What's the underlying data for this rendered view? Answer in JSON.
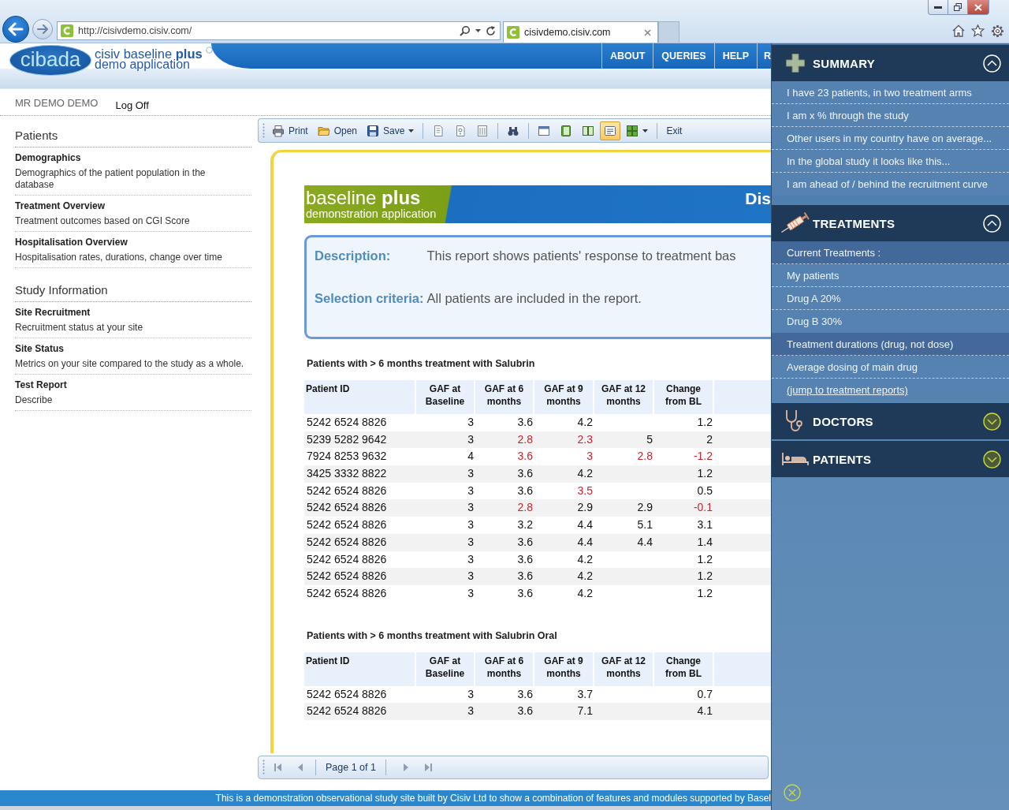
{
  "browser": {
    "address": "http://cisivdemo.cisiv.com/",
    "tabs": [
      {
        "label": "cisivdemo.cisiv.com",
        "selected": true
      }
    ]
  },
  "header": {
    "logo": "cibada",
    "brand": [
      "cisiv baseline **plus**",
      "demo application"
    ],
    "nav": [
      "ABOUT",
      "QUERIES",
      "HELP",
      "R"
    ]
  },
  "user_bar": {
    "user": "MR DEMO DEMO",
    "log_off": "Log Off"
  },
  "sidebar": {
    "sections": [
      {
        "title": "Patients",
        "items": [
          {
            "title": "Demographics",
            "description": "Demographics of the patient population in the database"
          },
          {
            "title": "Treatment Overview",
            "description": "Treatment outcomes based on CGI Score"
          },
          {
            "title": "Hospitalisation Overview",
            "description": "Hospitalisation rates, durations, change over time"
          }
        ]
      },
      {
        "title": "Study Information",
        "items": [
          {
            "title": "Site Recruitment",
            "description": "Recruitment status at your site"
          },
          {
            "title": "Site Status",
            "description": "Metrics on your site compared to the study as a whole."
          },
          {
            "title": "Test Report",
            "description": "Describe"
          }
        ]
      }
    ]
  },
  "toolbar": {
    "groups": [
      [
        {
          "label": "Print",
          "selected": false
        },
        {
          "label": "Open",
          "selected": false
        },
        {
          "label": "Save",
          "selected": false,
          "dropdown": true
        }
      ],
      [
        {
          "selected": false
        },
        {
          "selected": false
        },
        {
          "selected": false
        }
      ],
      [
        {
          "selected": false
        }
      ],
      [
        {
          "selected": false
        },
        {
          "selected": false
        },
        {
          "selected": false
        },
        {
          "selected": true
        },
        {
          "selected": false,
          "dropdown": true
        }
      ],
      [
        {
          "label": "Exit",
          "selected": false
        }
      ]
    ]
  },
  "report": {
    "banner": {
      "title": "baseline **plus**",
      "subtitle": "demonstration application",
      "heading": "Dis"
    },
    "details": [
      {
        "label": "Description:",
        "text": "This report shows patients' response to treatment bas"
      },
      {
        "label": "Selection criteria:",
        "text": "All patients are included in the report."
      }
    ],
    "tables": [
      {
        "title": "Patients with > 6 months treatment with Salubrin",
        "columns": [
          "Patient ID",
          "GAF at Baseline",
          "GAF at 6 months",
          "GAF at 9 months",
          "GAF at 12 months",
          "Change from BL"
        ],
        "rows": [
          {
            "cells": [
              {
                "text": "5242 6524 8826",
                "flagged": false
              },
              {
                "text": "3",
                "flagged": false
              },
              {
                "text": "3.6",
                "flagged": false
              },
              {
                "text": "4.2",
                "flagged": false
              },
              null,
              {
                "text": "1.2",
                "flagged": false
              }
            ]
          },
          {
            "cells": [
              {
                "text": "5239 5282 9642",
                "flagged": false
              },
              {
                "text": "3",
                "flagged": false
              },
              {
                "text": "2.8",
                "flagged": true
              },
              {
                "text": "2.3",
                "flagged": true
              },
              {
                "text": "5",
                "flagged": false
              },
              {
                "text": "2",
                "flagged": false
              }
            ]
          },
          {
            "cells": [
              {
                "text": "7924 8253 9632",
                "flagged": false
              },
              {
                "text": "4",
                "flagged": false
              },
              {
                "text": "3.6",
                "flagged": true
              },
              {
                "text": "3",
                "flagged": true
              },
              {
                "text": "2.8",
                "flagged": true
              },
              {
                "text": "-1.2",
                "flagged": true
              }
            ]
          },
          {
            "cells": [
              {
                "text": "3425 3332 8822",
                "flagged": false
              },
              {
                "text": "3",
                "flagged": false
              },
              {
                "text": "3.6",
                "flagged": false
              },
              {
                "text": "4.2",
                "flagged": false
              },
              null,
              {
                "text": "1.2",
                "flagged": false
              }
            ]
          },
          {
            "cells": [
              {
                "text": "5242 6524 8826",
                "flagged": false
              },
              {
                "text": "3",
                "flagged": false
              },
              {
                "text": "3.6",
                "flagged": false
              },
              {
                "text": "3.5",
                "flagged": true
              },
              null,
              {
                "text": "0.5",
                "flagged": false
              }
            ]
          },
          {
            "cells": [
              {
                "text": "5242 6524 8826",
                "flagged": false
              },
              {
                "text": "3",
                "flagged": false
              },
              {
                "text": "2.8",
                "flagged": true
              },
              {
                "text": "2.9",
                "flagged": false
              },
              {
                "text": "2.9",
                "flagged": false
              },
              {
                "text": "-0.1",
                "flagged": true
              }
            ]
          },
          {
            "cells": [
              {
                "text": "5242 6524 8826",
                "flagged": false
              },
              {
                "text": "3",
                "flagged": false
              },
              {
                "text": "3.2",
                "flagged": false
              },
              {
                "text": "4.4",
                "flagged": false
              },
              {
                "text": "5.1",
                "flagged": false
              },
              {
                "text": "3.1",
                "flagged": false
              }
            ]
          },
          {
            "cells": [
              {
                "text": "5242 6524 8826",
                "flagged": false
              },
              {
                "text": "3",
                "flagged": false
              },
              {
                "text": "3.6",
                "flagged": false
              },
              {
                "text": "4.4",
                "flagged": false
              },
              {
                "text": "4.4",
                "flagged": false
              },
              {
                "text": "1.4",
                "flagged": false
              }
            ]
          },
          {
            "cells": [
              {
                "text": "5242 6524 8826",
                "flagged": false
              },
              {
                "text": "3",
                "flagged": false
              },
              {
                "text": "3.6",
                "flagged": false
              },
              {
                "text": "4.2",
                "flagged": false
              },
              null,
              {
                "text": "1.2",
                "flagged": false
              }
            ]
          },
          {
            "cells": [
              {
                "text": "5242 6524 8826",
                "flagged": false
              },
              {
                "text": "3",
                "flagged": false
              },
              {
                "text": "3.6",
                "flagged": false
              },
              {
                "text": "4.2",
                "flagged": false
              },
              null,
              {
                "text": "1.2",
                "flagged": false
              }
            ]
          },
          {
            "cells": [
              {
                "text": "5242 6524 8826",
                "flagged": false
              },
              {
                "text": "3",
                "flagged": false
              },
              {
                "text": "3.6",
                "flagged": false
              },
              {
                "text": "4.2",
                "flagged": false
              },
              null,
              {
                "text": "1.2",
                "flagged": false
              }
            ]
          }
        ]
      },
      {
        "title": "Patients with > 6 months treatment with Salubrin Oral",
        "columns": [
          "Patient ID",
          "GAF at Baseline",
          "GAF at 6 months",
          "GAF at 9 months",
          "GAF at 12 months",
          "Change from BL"
        ],
        "rows": [
          {
            "cells": [
              {
                "text": "5242 6524 8826",
                "flagged": false
              },
              {
                "text": "3",
                "flagged": false
              },
              {
                "text": "3.6",
                "flagged": false
              },
              {
                "text": "3.7",
                "flagged": false
              },
              null,
              {
                "text": "0.7",
                "flagged": false
              }
            ]
          },
          {
            "cells": [
              {
                "text": "5242 6524 8826",
                "flagged": false
              },
              {
                "text": "3",
                "flagged": false
              },
              {
                "text": "3.6",
                "flagged": false
              },
              {
                "text": "7.1",
                "flagged": false
              },
              null,
              {
                "text": "4.1",
                "flagged": false
              }
            ]
          }
        ]
      }
    ]
  },
  "pager": {
    "controls": [
      {
        "kind": "button",
        "disabled": true
      },
      {
        "kind": "button",
        "disabled": true
      },
      {
        "kind": "label",
        "text": "Page 1 of 1"
      },
      {
        "kind": "button",
        "disabled": true
      },
      {
        "kind": "button",
        "disabled": true
      }
    ]
  },
  "footer": {
    "text": "This is a demonstration observational study site built by Cisiv Ltd to show a combination of features and modules supported by Basel"
  },
  "panel": {
    "sections": [
      {
        "title": "SUMMARY",
        "expanded": true,
        "items": [
          {
            "kind": "item",
            "label": "I have 23 patients, in two treatment arms"
          },
          {
            "kind": "item",
            "label": "I am x % through the study"
          },
          {
            "kind": "item",
            "label": "Other users in my country have on average..."
          },
          {
            "kind": "item",
            "label": "In the global study it looks like this..."
          },
          {
            "kind": "item",
            "label": "I am ahead of / behind the recruitment curve"
          }
        ]
      },
      {
        "title": "TREATMENTS",
        "expanded": true,
        "items": [
          {
            "kind": "heading",
            "label": "Current Treatments :"
          },
          {
            "kind": "item",
            "label": "My patients"
          },
          {
            "kind": "item",
            "label": "Drug A 20%"
          },
          {
            "kind": "item",
            "label": "Drug B 30%"
          },
          {
            "kind": "heading",
            "label": "Treatment durations (drug, not dose)"
          },
          {
            "kind": "item",
            "label": "Average dosing of main drug"
          },
          {
            "kind": "link",
            "label": "(jump to treatment reports)"
          }
        ]
      },
      {
        "title": "DOCTORS",
        "expanded": false
      },
      {
        "title": "PATIENTS",
        "expanded": false
      }
    ]
  }
}
